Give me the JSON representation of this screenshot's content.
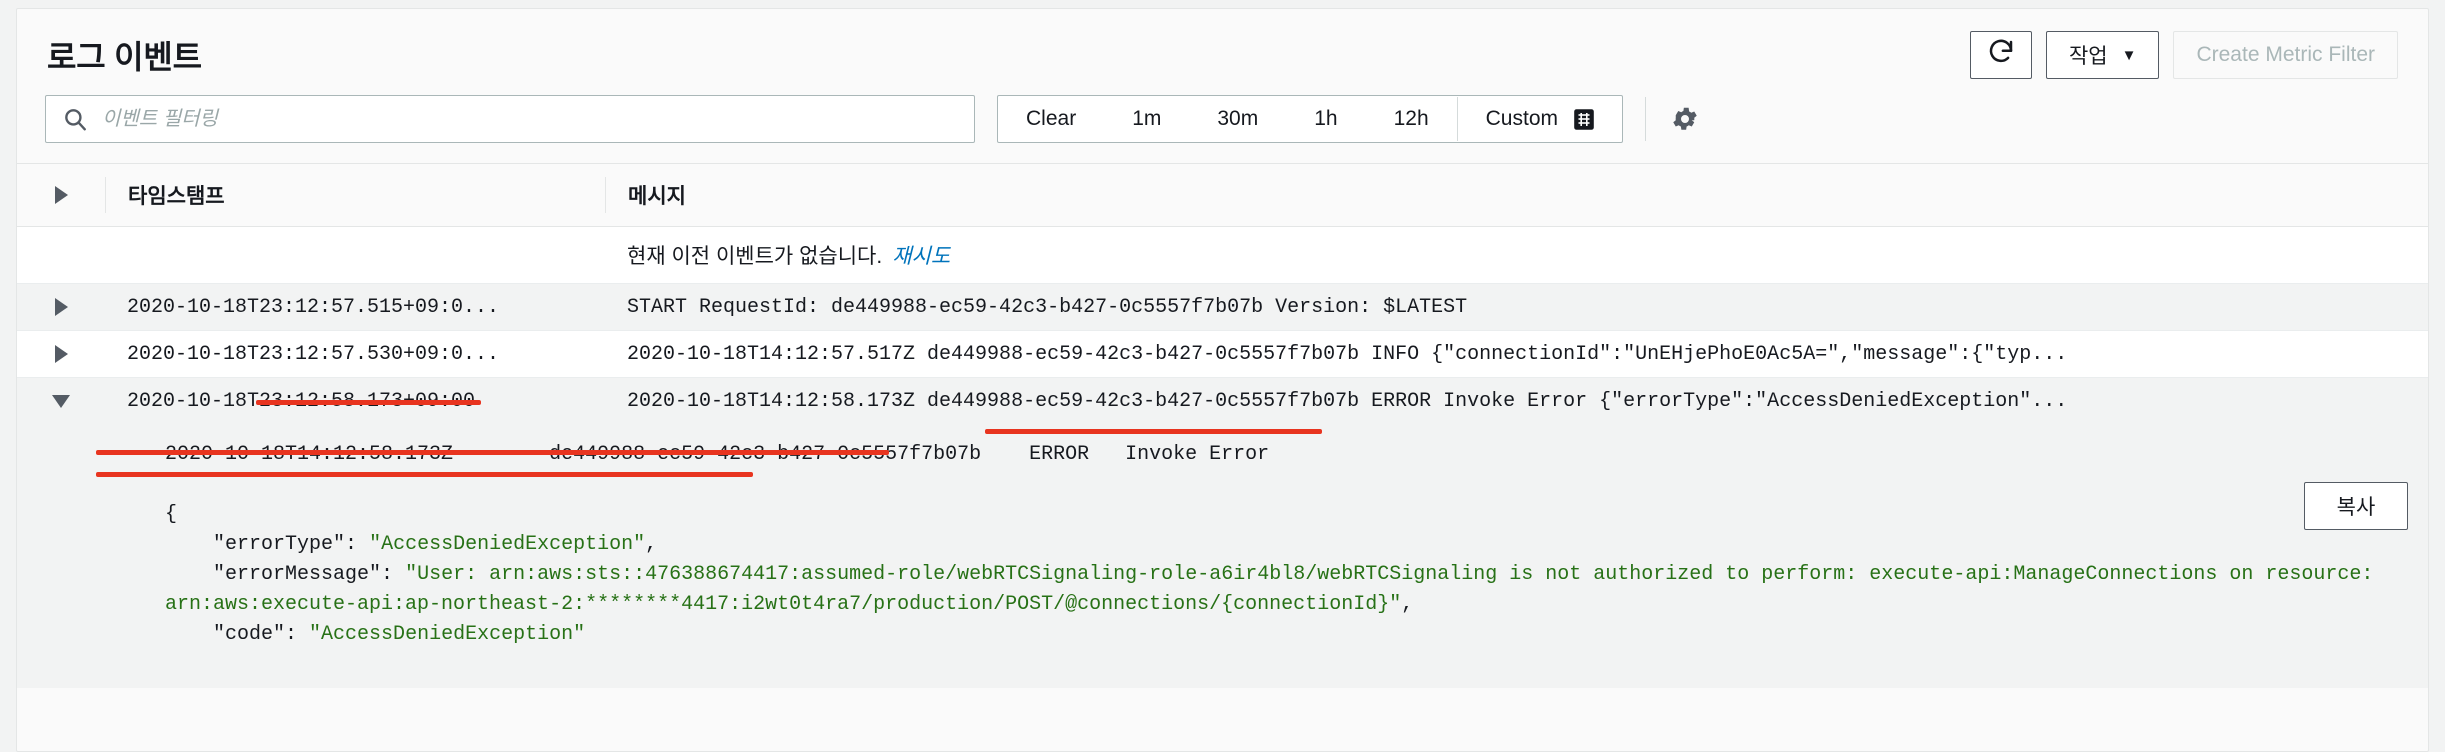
{
  "header": {
    "title": "로그 이벤트",
    "refresh_icon": "refresh-icon",
    "actions_label": "작업",
    "actions_caret": "▼",
    "create_metric_filter_label": "Create Metric Filter"
  },
  "filter": {
    "search_icon": "search-icon",
    "search_placeholder": "이벤트 필터링",
    "search_value": "",
    "ranges": [
      "Clear",
      "1m",
      "30m",
      "1h",
      "12h"
    ],
    "custom_label": "Custom",
    "calendar_icon": "calendar-icon",
    "settings_icon": "gear-icon"
  },
  "table": {
    "columns": {
      "toggle": "",
      "timestamp": "타임스탬프",
      "message": "메시지"
    },
    "empty_notice": {
      "text": "현재 이전 이벤트가 없습니다.",
      "retry_label": "재시도"
    },
    "rows": [
      {
        "expanded": false,
        "timestamp": "2020-10-18T23:12:57.515+09:0...",
        "message": "START RequestId: de449988-ec59-42c3-b427-0c5557f7b07b Version: $LATEST"
      },
      {
        "expanded": false,
        "timestamp": "2020-10-18T23:12:57.530+09:0...",
        "message": "2020-10-18T14:12:57.517Z de449988-ec59-42c3-b427-0c5557f7b07b INFO {\"connectionId\":\"UnEHjePhoE0Ac5A=\",\"message\":{\"typ..."
      },
      {
        "expanded": true,
        "timestamp": "2020-10-18T23:12:58.173+09:00",
        "message": "2020-10-18T14:12:58.173Z de449988-ec59-42c3-b427-0c5557f7b07b ERROR Invoke Error {\"errorType\":\"AccessDeniedException\"..."
      }
    ]
  },
  "detail": {
    "head_line": "2020-10-18T14:12:58.173Z\tde449988-ec59-42c3-b427-0c5557f7b07b\tERROR\tInvoke Error",
    "brace_open": "{",
    "error_type_key": "    \"errorType\":",
    "error_type_value": "\"AccessDeniedException\"",
    "error_message_key": "    \"errorMessage\":",
    "error_message_value": "\"User: arn:aws:sts::476388674417:assumed-role/webRTCSignaling-role-a6ir4bl8/webRTCSignaling is not authorized to perform: execute-api:ManageConnections on resource: arn:aws:execute-api:ap-northeast-2:********4417:i2wt0t4ra7/production/POST/@connections/{connectionId}\"",
    "code_key": "    \"code\":",
    "code_value": "\"AccessDeniedException\"",
    "copy_label": "복사"
  },
  "colors": {
    "accent": "#0073bb",
    "string_green": "#277116",
    "annotation_red": "#e8341f",
    "panel_bg": "#fafafa",
    "page_bg": "#f2f3f3"
  }
}
